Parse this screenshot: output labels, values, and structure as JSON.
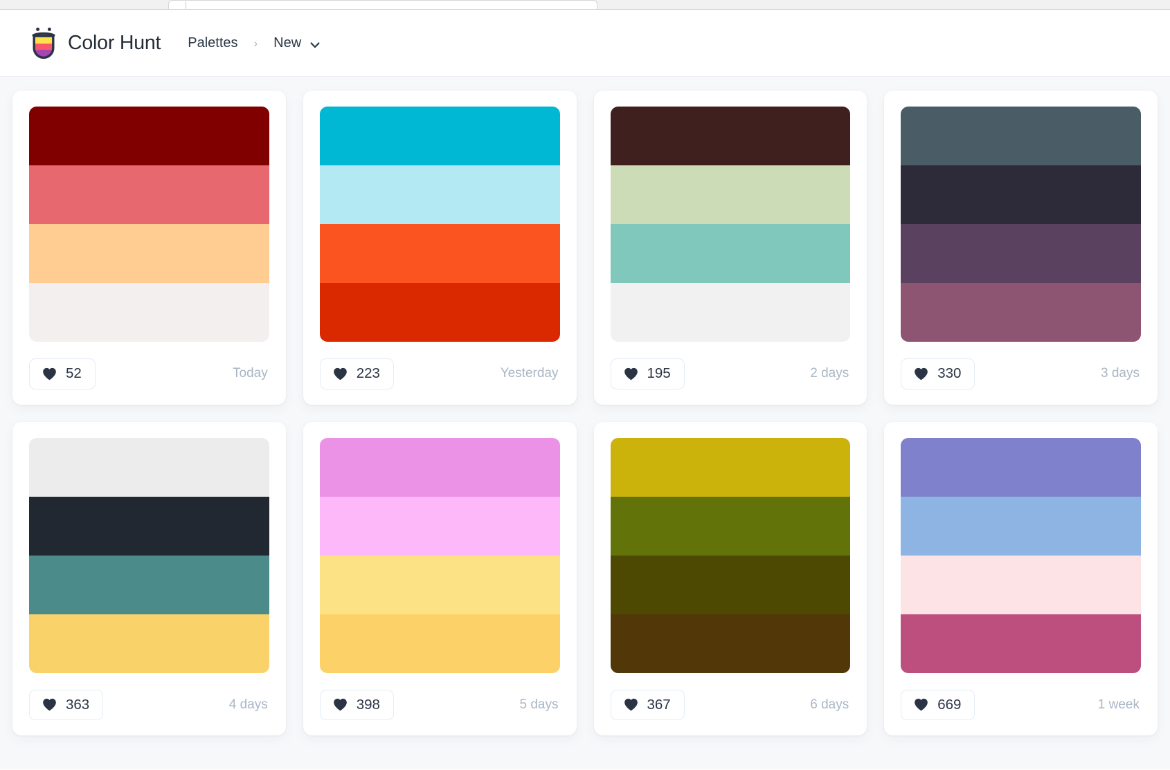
{
  "browser": {
    "tab_strip_visible": true
  },
  "header": {
    "logo_icon": "colorhunt-cup-logo-icon",
    "brand": "Color Hunt",
    "breadcrumb": {
      "root": "Palettes",
      "separator": "›",
      "current": "New",
      "chevron_icon": "chevron-down-icon"
    }
  },
  "logo_colors": {
    "outline": "#2b3445",
    "stripe1": "#ffe14d",
    "stripe2": "#f9566a",
    "stripe3": "#a845b5"
  },
  "ui_colors": {
    "page_background": "#f7f8fa",
    "card_background": "#ffffff",
    "text_primary": "#2b3445",
    "text_muted": "#a9b6c6",
    "button_border": "#e3edf5",
    "heart_fill": "#2b3445"
  },
  "palettes": [
    {
      "id": "palette-1",
      "colors": [
        "#800000",
        "#E8686F",
        "#FFCC91",
        "#F4EFEF"
      ],
      "likes": "52",
      "time": "Today",
      "heart_icon": "heart-icon"
    },
    {
      "id": "palette-2",
      "colors": [
        "#00B8D4",
        "#B2E9F2",
        "#FB5421",
        "#DA2900"
      ],
      "likes": "223",
      "time": "Yesterday",
      "heart_icon": "heart-icon"
    },
    {
      "id": "palette-3",
      "colors": [
        "#3F201E",
        "#CCDCB7",
        "#81C8BC",
        "#F1F1F1"
      ],
      "likes": "195",
      "time": "2 days",
      "heart_icon": "heart-icon"
    },
    {
      "id": "palette-4",
      "colors": [
        "#4A5C66",
        "#2D2B3A",
        "#5B4160",
        "#8E5572"
      ],
      "likes": "330",
      "time": "3 days",
      "heart_icon": "heart-icon"
    },
    {
      "id": "palette-5",
      "colors": [
        "#ECECEC",
        "#212831",
        "#4B8B8A",
        "#F9D269"
      ],
      "likes": "363",
      "time": "4 days",
      "heart_icon": "heart-icon"
    },
    {
      "id": "palette-6",
      "colors": [
        "#EC92E6",
        "#FCB8F9",
        "#FDE285",
        "#FCD168"
      ],
      "likes": "398",
      "time": "5 days",
      "heart_icon": "heart-icon"
    },
    {
      "id": "palette-7",
      "colors": [
        "#CBB30B",
        "#627309",
        "#4D4802",
        "#523808"
      ],
      "likes": "367",
      "time": "6 days",
      "heart_icon": "heart-icon"
    },
    {
      "id": "palette-8",
      "colors": [
        "#8081CC",
        "#8DB4E3",
        "#FDE2E6",
        "#BC4F7D"
      ],
      "likes": "669",
      "time": "1 week",
      "heart_icon": "heart-icon"
    }
  ]
}
